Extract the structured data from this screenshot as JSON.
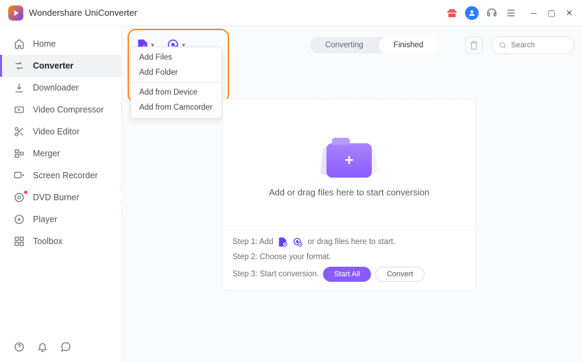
{
  "app": {
    "title": "Wondershare UniConverter"
  },
  "sidebar": {
    "items": [
      {
        "label": "Home"
      },
      {
        "label": "Converter"
      },
      {
        "label": "Downloader"
      },
      {
        "label": "Video Compressor"
      },
      {
        "label": "Video Editor"
      },
      {
        "label": "Merger"
      },
      {
        "label": "Screen Recorder"
      },
      {
        "label": "DVD Burner"
      },
      {
        "label": "Player"
      },
      {
        "label": "Toolbox"
      }
    ]
  },
  "tabs": {
    "converting": "Converting",
    "finished": "Finished"
  },
  "search": {
    "placeholder": "Search"
  },
  "dropdown": {
    "items": [
      "Add Files",
      "Add Folder",
      "Add from Device",
      "Add from Camcorder"
    ]
  },
  "dropzone": {
    "text": "Add or drag files here to start conversion"
  },
  "steps": {
    "s1_prefix": "Step 1: Add",
    "s1_suffix": "or drag files here to start.",
    "s2": "Step 2: Choose your format.",
    "s3": "Step 3: Start conversion.",
    "start_all": "Start All",
    "convert": "Convert"
  }
}
